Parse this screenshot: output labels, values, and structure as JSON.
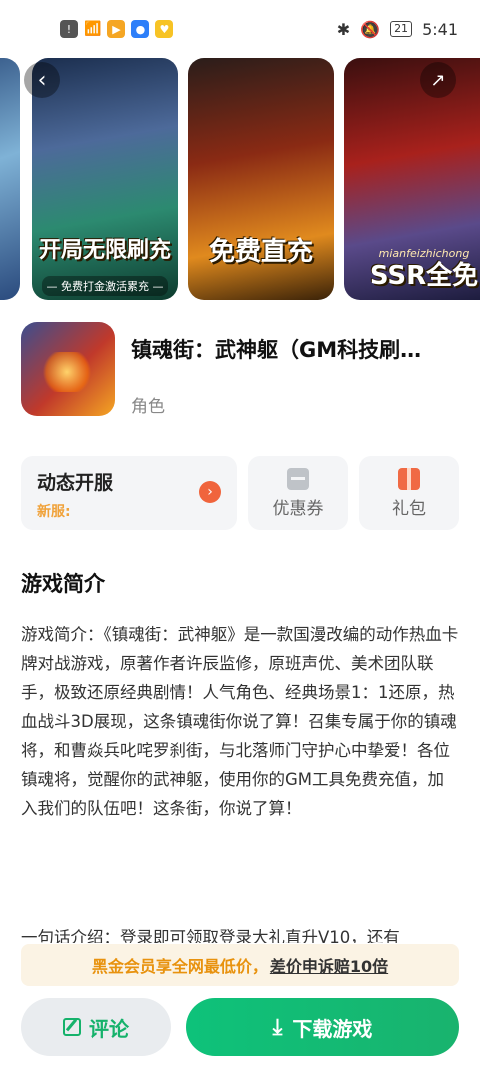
{
  "status_bar": {
    "time": "5:41",
    "battery": "21"
  },
  "banner": {
    "cards": [
      {
        "caption": "",
        "sub": ""
      },
      {
        "caption": "开局无限刷充",
        "sub": "— 免费打金激活累充 —"
      },
      {
        "caption": "免费直充",
        "sub": ""
      },
      {
        "caption": "SSR全免",
        "sub": "mianfeizhichong"
      }
    ]
  },
  "app": {
    "title": "镇魂街：武神躯（GM科技刷…",
    "category": "角色"
  },
  "services": {
    "server_title": "动态开服",
    "server_sub": "新服:",
    "coupon_label": "优惠券",
    "gift_label": "礼包"
  },
  "intro": {
    "section_title": "游戏简介",
    "body": "游戏简介：《镇魂街：武神躯》是一款国漫改编的动作热血卡牌对战游戏，原著作者许辰监修，原班声优、美术团队联手，极致还原经典剧情！人气角色、经典场景1：1还原，热血战斗3D展现，这条镇魂街你说了算！召集专属于你的镇魂将，和曹焱兵叱咤罗刹街，与北落师门守护心中挚爱！各位镇魂将，觉醒你的武神躯，使用你的GM工具免费充值，加入我们的队伍吧！这条街，你说了算！",
    "body2": "一句话介绍：登录即可领取登录大礼直升V10，还有"
  },
  "promo": {
    "text": "黑金会员享全网最低价，",
    "link": "差价申诉赔10倍"
  },
  "actions": {
    "comment": "评论",
    "download": "下载游戏"
  }
}
